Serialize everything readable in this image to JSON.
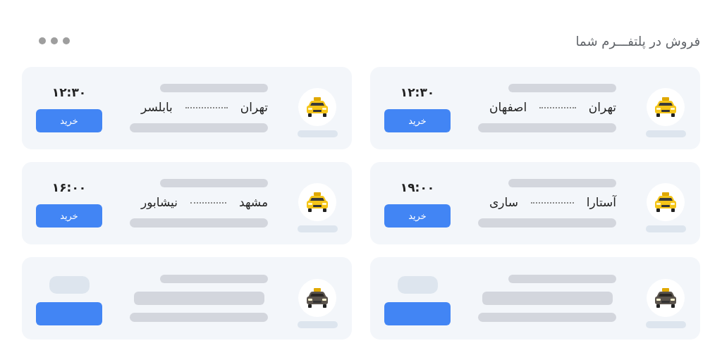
{
  "header": {
    "title": "فروش در پلتفـــرم شما"
  },
  "cards": [
    {
      "kind": "route",
      "origin": "تهران",
      "destination": "اصفهان",
      "time": "۱۲:۳۰",
      "button": "خرید"
    },
    {
      "kind": "route",
      "origin": "تهران",
      "destination": "بابلسر",
      "time": "۱۲:۳۰",
      "button": "خرید"
    },
    {
      "kind": "route",
      "origin": "آستارا",
      "destination": "ساری",
      "time": "۱۹:۰۰",
      "button": "خرید"
    },
    {
      "kind": "route",
      "origin": "مشهد",
      "destination": "نیشابور",
      "time": "۱۶:۰۰",
      "button": "خرید"
    },
    {
      "kind": "placeholder"
    },
    {
      "kind": "placeholder"
    }
  ]
}
